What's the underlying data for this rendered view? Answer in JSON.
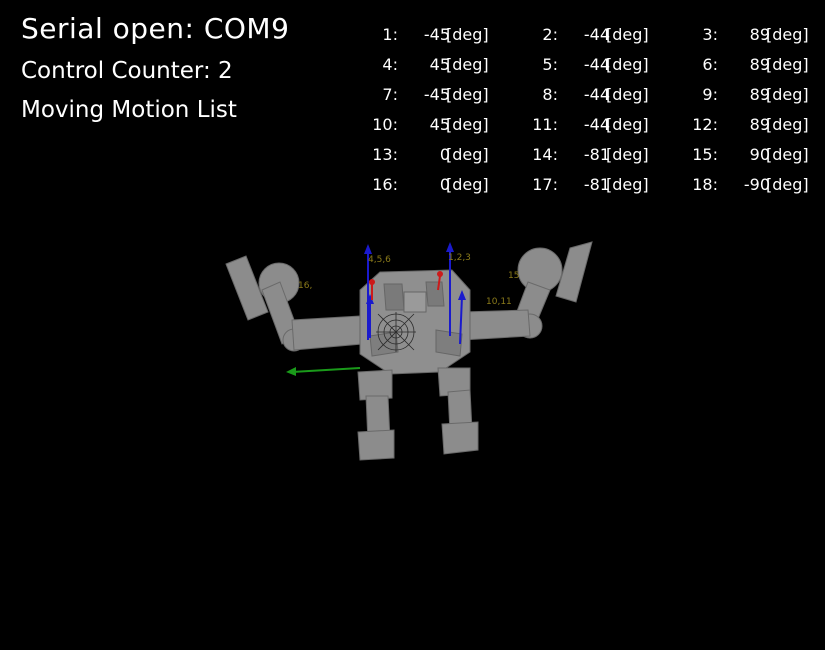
{
  "status": {
    "serial": "Serial open: COM9",
    "control_counter": "Control Counter: 2",
    "motion_list": "Moving Motion List"
  },
  "unit": "[deg]",
  "joints": [
    {
      "id": "1:",
      "value": "-45"
    },
    {
      "id": "2:",
      "value": "-44"
    },
    {
      "id": "3:",
      "value": "89"
    },
    {
      "id": "4:",
      "value": "45"
    },
    {
      "id": "5:",
      "value": "-44"
    },
    {
      "id": "6:",
      "value": "89"
    },
    {
      "id": "7:",
      "value": "-45"
    },
    {
      "id": "8:",
      "value": "-44"
    },
    {
      "id": "9:",
      "value": "89"
    },
    {
      "id": "10:",
      "value": "45"
    },
    {
      "id": "11:",
      "value": "-44"
    },
    {
      "id": "12:",
      "value": "89"
    },
    {
      "id": "13:",
      "value": "0"
    },
    {
      "id": "14:",
      "value": "-81"
    },
    {
      "id": "15:",
      "value": "90"
    },
    {
      "id": "16:",
      "value": "0"
    },
    {
      "id": "17:",
      "value": "-81"
    },
    {
      "id": "18:",
      "value": "-90"
    }
  ],
  "scene_labels": {
    "l1": "4,5,6",
    "l2": "1,2,3",
    "l3": "16,",
    "l4": "15",
    "l5": "10,11"
  },
  "colors": {
    "background": "#000000",
    "body": "#8c8c8c",
    "axis_z": "#1a1acc",
    "axis_y": "#1a9a1a",
    "axis_x": "#cc1a1a",
    "joint_label": "#8a7a1a"
  }
}
